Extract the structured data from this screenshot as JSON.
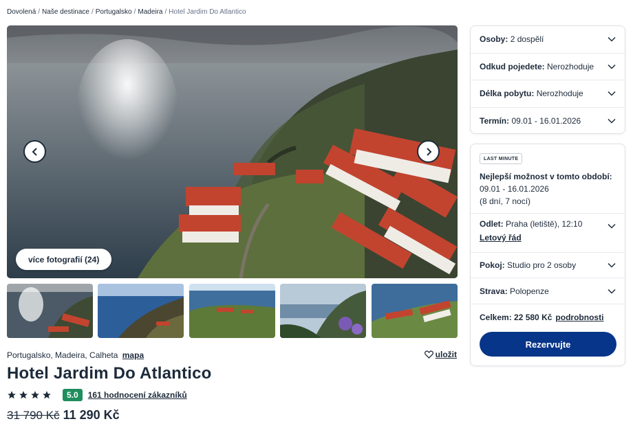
{
  "breadcrumb": {
    "items": [
      "Dovolená",
      "Naše destinace",
      "Portugalsko",
      "Madeira"
    ],
    "current": "Hotel Jardim Do Atlantico"
  },
  "gallery": {
    "more_photos_label": "více fotografií (24)",
    "prev_icon": "chevron-left-icon",
    "next_icon": "chevron-right-icon"
  },
  "hotel": {
    "location": "Portugalsko, Madeira, Calheta",
    "map_link": "mapa",
    "save_label": "uložit",
    "name": "Hotel Jardim Do Atlantico",
    "stars": 4,
    "score": "5.0",
    "reviews_link": "161 hodnocení zákazníků",
    "old_price": "31 790 Kč",
    "price": "11 290 Kč"
  },
  "filters": [
    {
      "label": "Osoby:",
      "value": "2 dospělí"
    },
    {
      "label": "Odkud pojedete:",
      "value": "Nerozhoduje"
    },
    {
      "label": "Délka pobytu:",
      "value": "Nerozhoduje"
    },
    {
      "label": "Termín:",
      "value": "09.01 - 16.01.2026"
    }
  ],
  "offer": {
    "badge": "LAST MINUTE",
    "best_heading": "Nejlepší možnost v tomto období:",
    "dates": "09.01 - 16.01.2026",
    "duration": "(8 dní, 7 nocí)",
    "departure_label": "Odlet:",
    "departure_value": "Praha (letiště), 12:10",
    "schedule_link": "Letový řád",
    "room_label": "Pokoj:",
    "room_value": "Studio pro 2 osoby",
    "board_label": "Strava:",
    "board_value": "Polopenze",
    "total_label": "Celkem:",
    "total_value": "22 580 Kč",
    "details_link": "podrobnosti",
    "reserve_button": "Rezervujte"
  },
  "colors": {
    "text": "#1d2a3a",
    "accent_button": "#073589",
    "score_badge": "#1f8e5c",
    "roof": "#c2442f"
  }
}
